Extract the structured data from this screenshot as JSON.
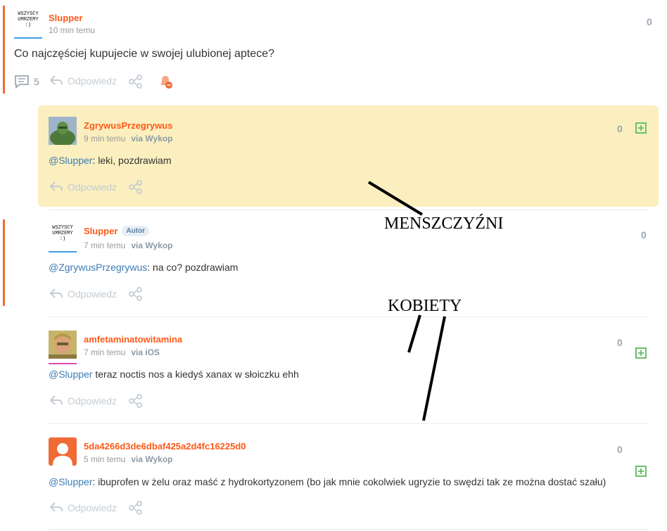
{
  "post": {
    "author": "Slupper",
    "avatar_text": "WSZYSCY UMRZEMY :)",
    "time": "10 min temu",
    "votes": "0",
    "body": "Co najczęściej kupujecie w swojej ulubionej aptece?",
    "comments_count": "5",
    "reply_label": "Odpowiedz"
  },
  "comments": [
    {
      "author": "ZgrywusPrzegrywus",
      "time": "9 min temu",
      "via": "via Wykop",
      "votes": "0",
      "mention": "@Slupper",
      "text": ": leki, pozdrawiam",
      "reply_label": "Odpowiedz"
    },
    {
      "author": "Slupper",
      "badge": "Autor",
      "avatar_text": "WSZYSCY UMRZEMY :)",
      "time": "7 min temu",
      "via": "via Wykop",
      "votes": "0",
      "mention": "@ZgrywusPrzegrywus",
      "text": ": na co? pozdrawiam",
      "reply_label": "Odpowiedz"
    },
    {
      "author": "amfetaminatowitamina",
      "time": "7 min temu",
      "via": "via iOS",
      "votes": "0",
      "mention": "@Slupper",
      "text": " teraz noctis nos a kiedyś xanax w słoiczku ehh",
      "reply_label": "Odpowiedz"
    },
    {
      "author": "5da4266d3de6dbaf425a2d4fc16225d0",
      "time": "5 min temu",
      "via": "via Wykop",
      "votes": "0",
      "mention": "@Slupper",
      "text": ": ibuprofen w żelu oraz maść z hydrokortyzonem (bo jak mnie cokolwiek ugryzie to swędzi tak ze można dostać szału)",
      "reply_label": "Odpowiedz"
    }
  ],
  "annotations": {
    "men": "MENSZCZYŹNI",
    "women": "KOBIETY"
  },
  "colors": {
    "accent": "#ff5917",
    "highlight_bg": "#fbefbf",
    "mention": "#3c7cb5",
    "plus": "#6bbf6b"
  }
}
